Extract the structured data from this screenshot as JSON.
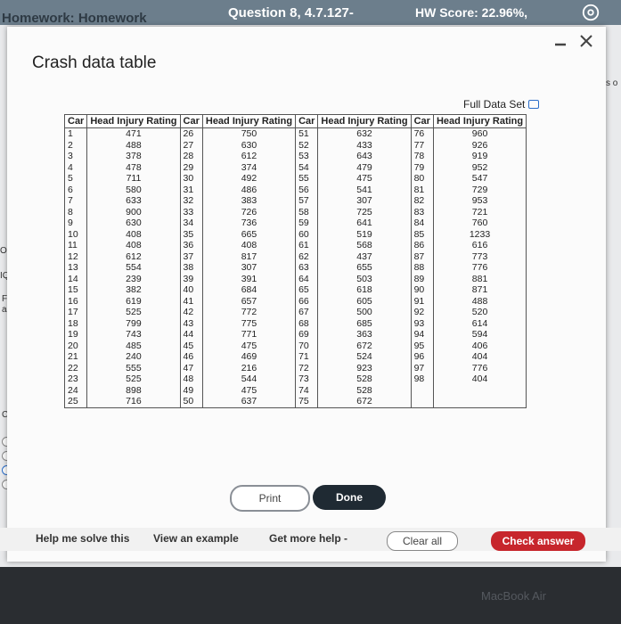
{
  "header": {
    "homework_title": "Homework: Homework",
    "question": "Question 8, 4.7.127-",
    "score": "HW Score: 22.96%,"
  },
  "dialog": {
    "title": "Crash data table",
    "full_data_label": "Full Data Set"
  },
  "table": {
    "headers": [
      "Car",
      "Head Injury Rating",
      "Car",
      "Head Injury Rating",
      "Car",
      "Head Injury Rating",
      "Car",
      "Head Injury Rating"
    ],
    "rows": [
      [
        "1",
        "471",
        "26",
        "750",
        "51",
        "632",
        "76",
        "960"
      ],
      [
        "2",
        "488",
        "27",
        "630",
        "52",
        "433",
        "77",
        "926"
      ],
      [
        "3",
        "378",
        "28",
        "612",
        "53",
        "643",
        "78",
        "919"
      ],
      [
        "4",
        "478",
        "29",
        "374",
        "54",
        "479",
        "79",
        "952"
      ],
      [
        "5",
        "711",
        "30",
        "492",
        "55",
        "475",
        "80",
        "547"
      ],
      [
        "6",
        "580",
        "31",
        "486",
        "56",
        "541",
        "81",
        "729"
      ],
      [
        "7",
        "633",
        "32",
        "383",
        "57",
        "307",
        "82",
        "953"
      ],
      [
        "8",
        "900",
        "33",
        "726",
        "58",
        "725",
        "83",
        "721"
      ],
      [
        "9",
        "630",
        "34",
        "736",
        "59",
        "641",
        "84",
        "760"
      ],
      [
        "10",
        "408",
        "35",
        "665",
        "60",
        "519",
        "85",
        "1233"
      ],
      [
        "11",
        "408",
        "36",
        "408",
        "61",
        "568",
        "86",
        "616"
      ],
      [
        "12",
        "612",
        "37",
        "817",
        "62",
        "437",
        "87",
        "773"
      ],
      [
        "13",
        "554",
        "38",
        "307",
        "63",
        "655",
        "88",
        "776"
      ],
      [
        "14",
        "239",
        "39",
        "391",
        "64",
        "503",
        "89",
        "881"
      ],
      [
        "15",
        "382",
        "40",
        "684",
        "65",
        "618",
        "90",
        "871"
      ],
      [
        "16",
        "619",
        "41",
        "657",
        "66",
        "605",
        "91",
        "488"
      ],
      [
        "17",
        "525",
        "42",
        "772",
        "67",
        "500",
        "92",
        "520"
      ],
      [
        "18",
        "799",
        "43",
        "775",
        "68",
        "685",
        "93",
        "614"
      ],
      [
        "19",
        "743",
        "44",
        "771",
        "69",
        "363",
        "94",
        "594"
      ],
      [
        "20",
        "485",
        "45",
        "475",
        "70",
        "672",
        "95",
        "406"
      ],
      [
        "21",
        "240",
        "46",
        "469",
        "71",
        "524",
        "96",
        "404"
      ],
      [
        "22",
        "555",
        "47",
        "216",
        "72",
        "923",
        "97",
        "776"
      ],
      [
        "23",
        "525",
        "48",
        "544",
        "73",
        "528",
        "98",
        "404"
      ],
      [
        "24",
        "898",
        "49",
        "475",
        "74",
        "528",
        "",
        ""
      ],
      [
        "25",
        "716",
        "50",
        "637",
        "75",
        "672",
        "",
        ""
      ]
    ]
  },
  "buttons": {
    "print": "Print",
    "done": "Done",
    "clear_all": "Clear all",
    "check_answer": "Check answer"
  },
  "footer": {
    "help": "Help me solve this",
    "example": "View an example",
    "more_help": "Get more help -"
  },
  "side_fragments": {
    "obta": "Obta",
    "iqr": "IQR",
    "find": "Find",
    "assu": "assu",
    "con": "Con",
    "right_frag": "s o"
  },
  "device_brand": "MacBook Air",
  "colors": {
    "header_bg": "#6c7e8c",
    "check_answer": "#c7262c",
    "done_button": "#1f2a33"
  }
}
